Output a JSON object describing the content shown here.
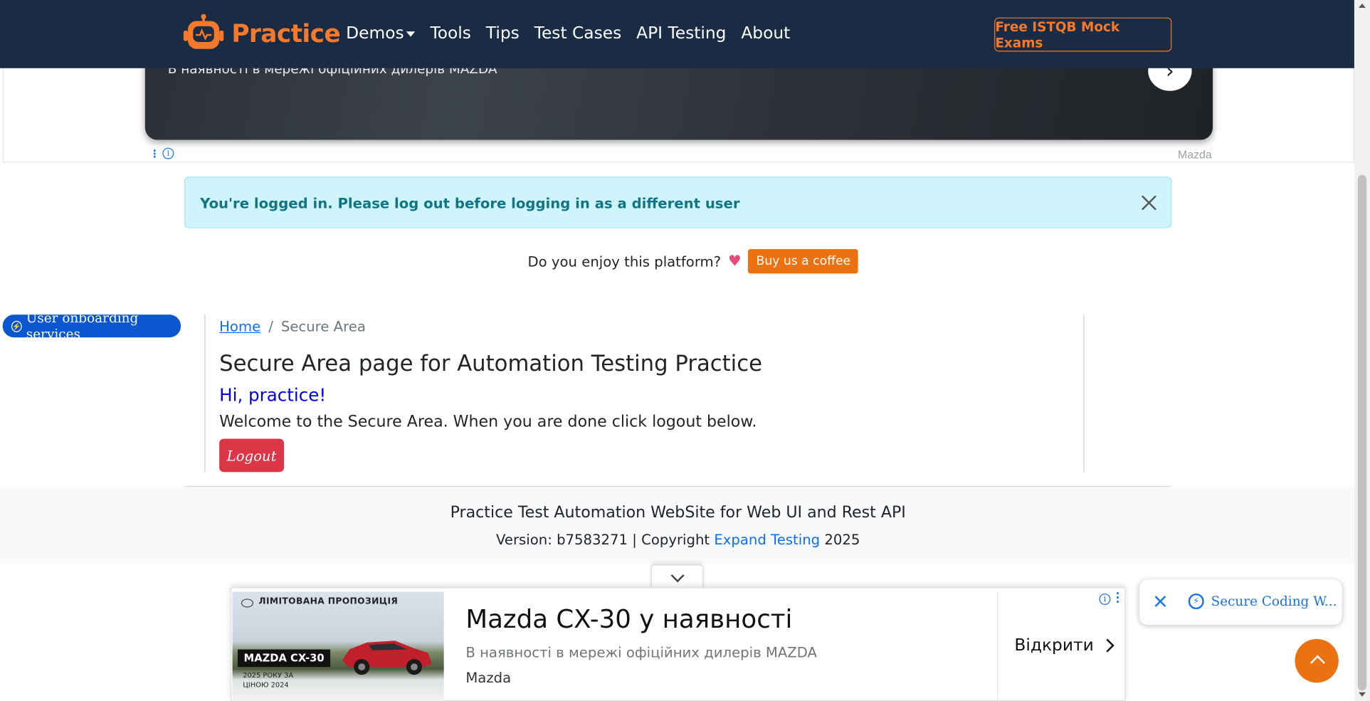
{
  "top_ad": {
    "text": "В наявності в мережі офіційних дилерів MAZDA",
    "brand": "Mazda",
    "info_glyph": "i",
    "arrow_glyph": "›"
  },
  "navbar": {
    "brand": "Practice",
    "items": [
      {
        "label": "Demos",
        "has_dropdown": true
      },
      {
        "label": "Tools"
      },
      {
        "label": "Tips"
      },
      {
        "label": "Test Cases"
      },
      {
        "label": "API Testing"
      },
      {
        "label": "About"
      }
    ],
    "cta": "Free ISTQB Mock Exams",
    "colors": {
      "background": "#1a2c45",
      "accent": "#f5792a"
    }
  },
  "alert": {
    "message": "You're logged in. Please log out before logging in as a different user"
  },
  "coffee": {
    "question": "Do you enjoy this platform?",
    "heart": "♥",
    "button": "Buy us a coffee"
  },
  "onboarding": {
    "label": "User onboarding services"
  },
  "breadcrumb": {
    "home": "Home",
    "separator": "/",
    "current": "Secure Area"
  },
  "main": {
    "title": "Secure Area page for Automation Testing Practice",
    "greeting": "Hi, practice!",
    "welcome": "Welcome to the Secure Area. When you are done click logout below.",
    "logout": "Logout"
  },
  "footer": {
    "title": "Practice Test Automation WebSite for Web UI and Rest API",
    "version_prefix": "Version: b7583271 | Copyright ",
    "company": "Expand Testing",
    "year": " 2025"
  },
  "bottom_ad": {
    "image_header": "ЛІМІТОВАНА ПРОПОЗИЦІЯ",
    "image_model": "MAZDA CX-30",
    "image_sub": "2025 РОКУ ЗА ЦІНОЮ 2024",
    "title": "Mazda CX-30 у наявності",
    "description": "В наявності в мережі офіційних дилерів MAZDA",
    "brand": "Mazda",
    "cta": "Відкрити"
  },
  "widget": {
    "label": "Secure Coding W..."
  }
}
